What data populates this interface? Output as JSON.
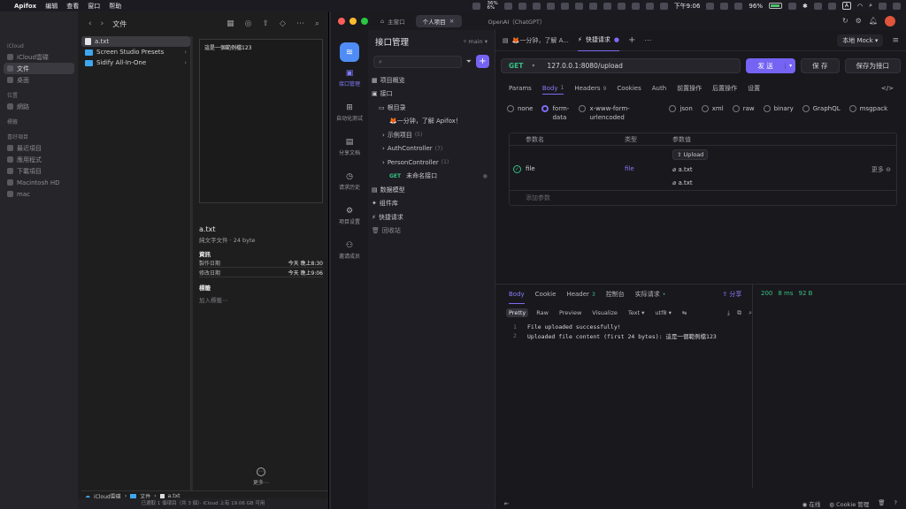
{
  "menubar": {
    "app": "Apifox",
    "items": [
      "编辑",
      "查看",
      "窗口",
      "帮助"
    ],
    "cpu_line1": "36%",
    "cpu_line2": "6%",
    "battery": "96%",
    "clock": "下午9:06"
  },
  "finder": {
    "title": "文件",
    "sidebar": {
      "icloud_header": "iCloud",
      "icloud_items": [
        "iCloud雲碟",
        "文件",
        "桌面"
      ],
      "location_header": "位置",
      "location_items": [
        "網路"
      ],
      "tags_header": "標籤",
      "fav_header": "喜好項目",
      "fav_items": [
        "最近項目",
        "應用程式",
        "下載項目",
        "Macintosh HD",
        "mac"
      ]
    },
    "files": [
      {
        "name": "a.txt",
        "folder": false
      },
      {
        "name": "Screen Studio Presets",
        "folder": true
      },
      {
        "name": "Sidify All-In-One",
        "folder": true
      }
    ],
    "preview_text": "這是一個範例檔123",
    "info": {
      "name": "a.txt",
      "meta": "純文字文件 · 24 byte",
      "section": "資訊",
      "created_label": "製作日期",
      "created_value": "今天 晚上8:30",
      "modified_label": "修改日期",
      "modified_value": "今天 晚上9:06",
      "tags_section": "標籤",
      "tags_placeholder": "加入標籤⋯"
    },
    "more_label": "更多⋯",
    "path": [
      "iCloud雲碟",
      "文件",
      "a.txt"
    ],
    "status": "已選取 1 個項目（共 3 個）· iCloud 上有 19.06 GB 可用"
  },
  "apifox": {
    "tabs": [
      {
        "label": "主窗口",
        "active": false
      },
      {
        "label": "个人项目",
        "active": true
      },
      {
        "label": "OpenAI（ChatGPT）",
        "active": false
      }
    ],
    "rail": [
      "接口管理",
      "自动化测试",
      "分享文档",
      "请求历史",
      "项目设置",
      "邀请成员"
    ],
    "nav": {
      "title": "接口管理",
      "branch": "main",
      "tree": [
        {
          "label": "项目概览",
          "count": "",
          "indent": 4,
          "muted": false
        },
        {
          "label": "接口",
          "count": "",
          "indent": 4,
          "muted": false
        },
        {
          "label": "根目录",
          "count": "",
          "indent": 12,
          "muted": false
        },
        {
          "label": "🦊一分钟，了解 Apifox！",
          "count": "",
          "indent": 24,
          "muted": false
        },
        {
          "label": "示例项目",
          "count": "(5)",
          "indent": 16,
          "muted": false
        },
        {
          "label": "AuthController",
          "count": "(7)",
          "indent": 16,
          "muted": false
        },
        {
          "label": "PersonController",
          "count": "(1)",
          "indent": 16,
          "muted": false
        },
        {
          "label": "未命名接口",
          "count": "",
          "indent": 24,
          "muted": false,
          "method": "GET"
        },
        {
          "label": "数据模型",
          "count": "",
          "indent": 4,
          "muted": false
        },
        {
          "label": "组件库",
          "count": "",
          "indent": 4,
          "muted": false
        },
        {
          "label": "快捷请求",
          "count": "",
          "indent": 4,
          "muted": false
        },
        {
          "label": "回收站",
          "count": "",
          "indent": 4,
          "muted": true
        }
      ]
    },
    "doc_tabs": {
      "tab1": "🦊一分钟，了解 A...",
      "tab2": "快捷请求",
      "env": "本地 Mock"
    },
    "request": {
      "method": "GET",
      "url": "127.0.0.1:8080/upload",
      "send": "发 送",
      "save": "保 存",
      "save_as": "保存为接口"
    },
    "req_tabs": [
      {
        "label": "Params",
        "n": "",
        "active": false
      },
      {
        "label": "Body",
        "n": "1",
        "active": true
      },
      {
        "label": "Headers",
        "n": "9",
        "active": false
      },
      {
        "label": "Cookies",
        "n": "",
        "active": false
      },
      {
        "label": "Auth",
        "n": "",
        "active": false
      },
      {
        "label": "前置操作",
        "n": "",
        "active": false
      },
      {
        "label": "后置操作",
        "n": "",
        "active": false
      },
      {
        "label": "设置",
        "n": "",
        "active": false
      }
    ],
    "body_types": [
      {
        "label": "none",
        "on": false
      },
      {
        "label": "form-data",
        "on": true
      },
      {
        "label": "x-www-form-urlencoded",
        "on": false
      },
      {
        "label": "json",
        "on": false
      },
      {
        "label": "xml",
        "on": false
      },
      {
        "label": "raw",
        "on": false
      },
      {
        "label": "binary",
        "on": false
      },
      {
        "label": "GraphQL",
        "on": false
      },
      {
        "label": "msgpack",
        "on": false
      }
    ],
    "params": {
      "h_name": "参数名",
      "h_type": "类型",
      "h_value": "参数值",
      "name": "file",
      "type": "file",
      "upload": "Upload",
      "files": [
        "a.txt",
        "a.txt"
      ],
      "more": "更多",
      "add_placeholder": "添加参数"
    },
    "response": {
      "tabs": [
        {
          "label": "Body",
          "n": "",
          "active": true
        },
        {
          "label": "Cookie",
          "n": "",
          "active": false
        },
        {
          "label": "Header",
          "n": "3",
          "active": false
        },
        {
          "label": "控制台",
          "n": "",
          "active": false
        },
        {
          "label": "实际请求",
          "n": "•",
          "active": false
        }
      ],
      "share": "分享",
      "status": "200",
      "time": "8 ms",
      "size": "92 B",
      "formats": [
        "Pretty",
        "Raw",
        "Preview",
        "Visualize",
        "Text",
        "utf8"
      ],
      "lines": [
        "File uploaded successfully!",
        "Uploaded file content (first 24 bytes): 這是一個範例檔123"
      ]
    },
    "footer": {
      "online": "在线",
      "cookie": "Cookie 管理"
    }
  }
}
